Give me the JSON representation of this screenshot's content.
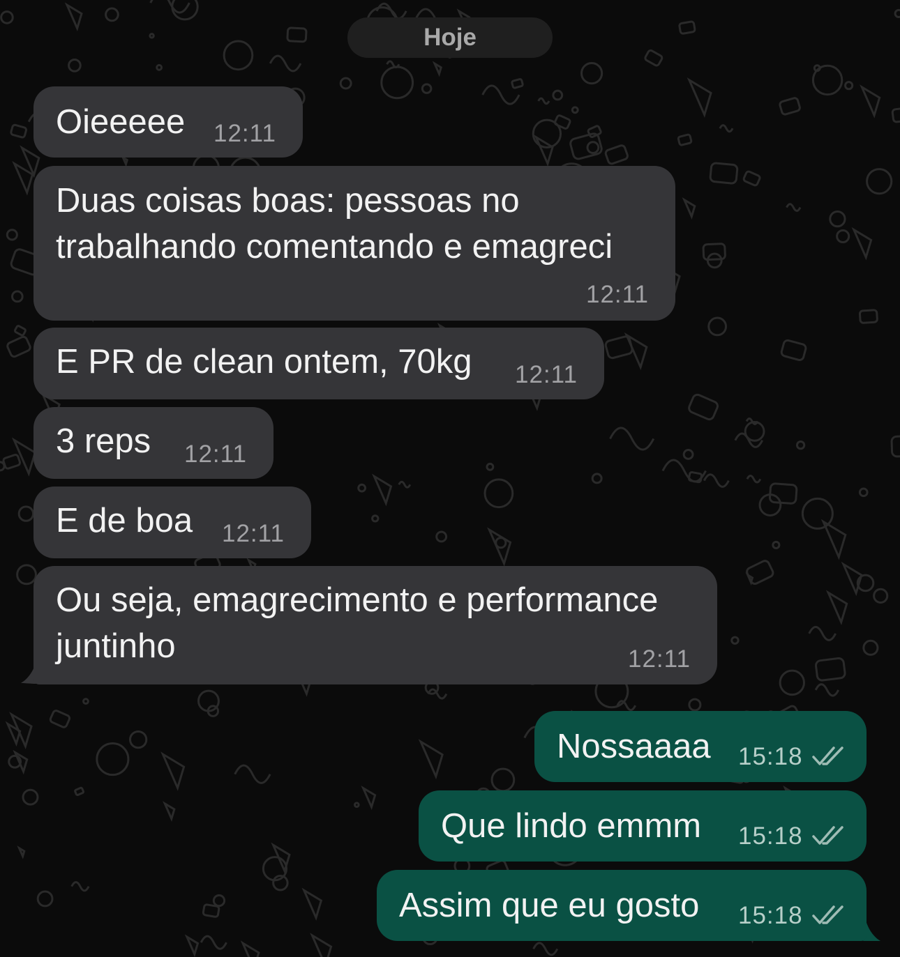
{
  "chat": {
    "date_label": "Hoje",
    "messages": [
      {
        "direction": "incoming",
        "text": "Oieeeee",
        "time": "12:11"
      },
      {
        "direction": "incoming",
        "text_line1": "Duas coisas boas: pessoas no",
        "text_line2": "trabalhando comentando e emagreci",
        "time": "12:11"
      },
      {
        "direction": "incoming",
        "text": "E PR de clean ontem, 70kg",
        "time": "12:11"
      },
      {
        "direction": "incoming",
        "text": "3 reps",
        "time": "12:11"
      },
      {
        "direction": "incoming",
        "text": "E de boa",
        "time": "12:11"
      },
      {
        "direction": "incoming",
        "text_line1": "Ou seja, emagrecimento e performance",
        "text_line2": "juntinho",
        "time": "12:11"
      },
      {
        "direction": "outgoing",
        "text": "Nossaaaa",
        "time": "15:18",
        "status": "read"
      },
      {
        "direction": "outgoing",
        "text": "Que lindo emmm",
        "time": "15:18",
        "status": "read"
      },
      {
        "direction": "outgoing",
        "text": "Assim que eu gosto",
        "time": "15:18",
        "status": "read"
      }
    ]
  },
  "colors": {
    "background": "#0b0b0b",
    "incoming_bubble": "#353538",
    "outgoing_bubble": "#0a5144",
    "read_ticks": "#9fbcb5"
  },
  "icons": {
    "read_receipt": "double-check-icon",
    "wallpaper": "doodle-pattern"
  }
}
